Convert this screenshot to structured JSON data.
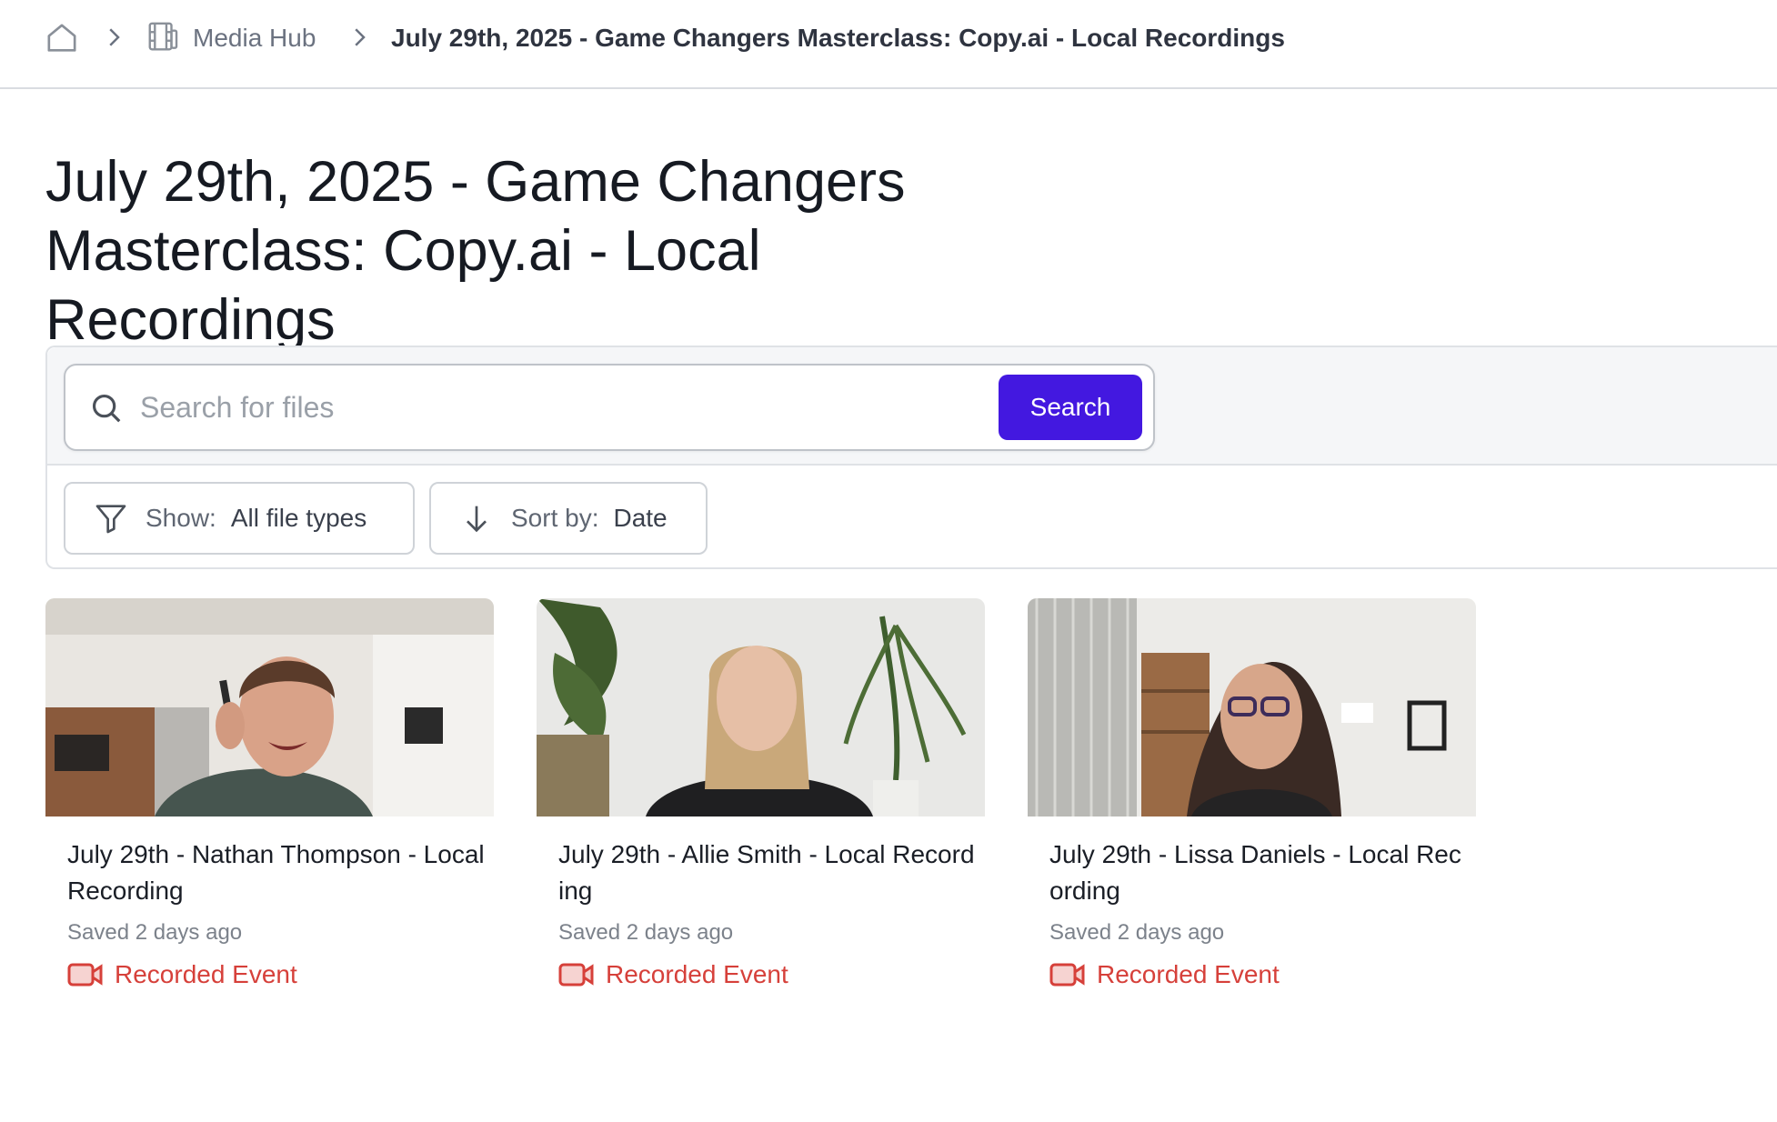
{
  "breadcrumb": {
    "home_icon": "home-icon",
    "media_hub": "Media Hub",
    "media_icon": "video-folder-icon",
    "current": "July 29th, 2025 - Game Changers Masterclass: Copy.ai - Local Recordings"
  },
  "page": {
    "title": "July 29th, 2025 - Game Changers Masterclass: Copy.ai - Local Recordings"
  },
  "search": {
    "placeholder": "Search for files",
    "value": "",
    "button_label": "Search"
  },
  "filters": {
    "show_label": "Show:",
    "show_value": "All file types",
    "sort_label": "Sort by:",
    "sort_value": "Date"
  },
  "colors": {
    "accent": "#4318e0",
    "recorded": "#d6403a"
  },
  "files": [
    {
      "title": "July 29th - Nathan Thompson - Local Recording",
      "saved": "Saved 2 days ago",
      "badge": "Recorded Event"
    },
    {
      "title": "July 29th - Allie Smith - Local Recording",
      "saved": "Saved 2 days ago",
      "badge": "Recorded Event"
    },
    {
      "title": "July 29th - Lissa Daniels - Local Recording",
      "saved": "Saved 2 days ago",
      "badge": "Recorded Event"
    }
  ]
}
